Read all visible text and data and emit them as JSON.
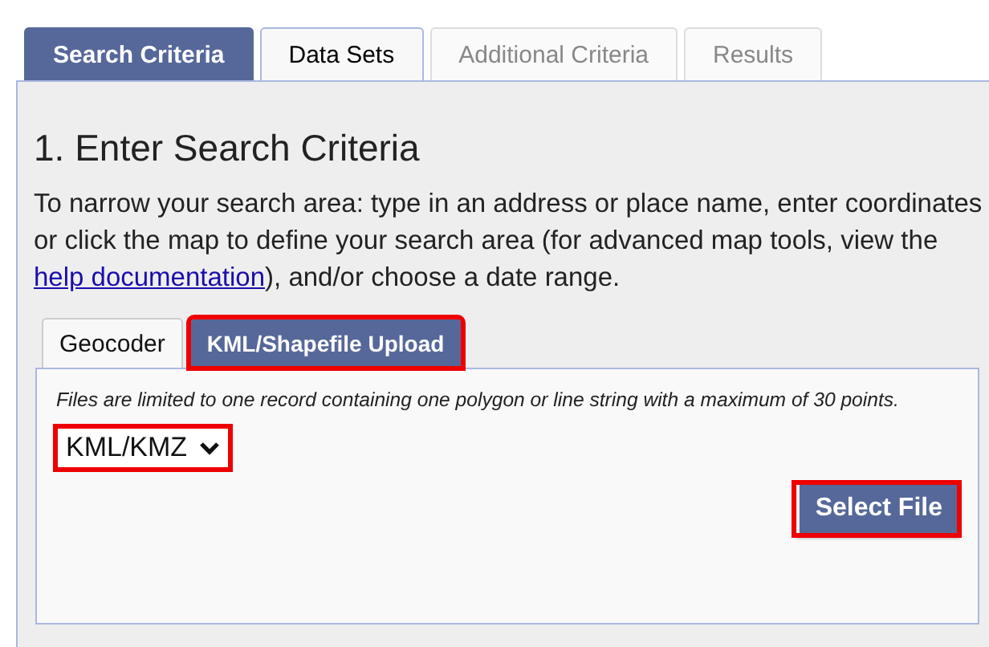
{
  "tabs": [
    {
      "label": "Search Criteria",
      "selected": true,
      "disabled": false
    },
    {
      "label": "Data Sets",
      "selected": false,
      "disabled": false
    },
    {
      "label": "Additional Criteria",
      "selected": false,
      "disabled": true
    },
    {
      "label": "Results",
      "selected": false,
      "disabled": true
    }
  ],
  "heading": "1. Enter Search Criteria",
  "intro": {
    "before": "To narrow your search area: type in an address or place name, enter coordinates or click the map to define your search area (for advanced map tools, view the ",
    "link": "help documentation",
    "after": "), and/or choose a date range."
  },
  "subtabs": [
    {
      "label": "Geocoder",
      "selected": false,
      "highlighted": false
    },
    {
      "label": "KML/Shapefile Upload",
      "selected": true,
      "highlighted": true
    }
  ],
  "note": "Files are limited to one record containing one polygon or line string with a maximum of 30 points.",
  "file_type": {
    "value": "KML/KMZ",
    "highlighted": true
  },
  "select_button": {
    "label": "Select File",
    "highlighted": true
  }
}
